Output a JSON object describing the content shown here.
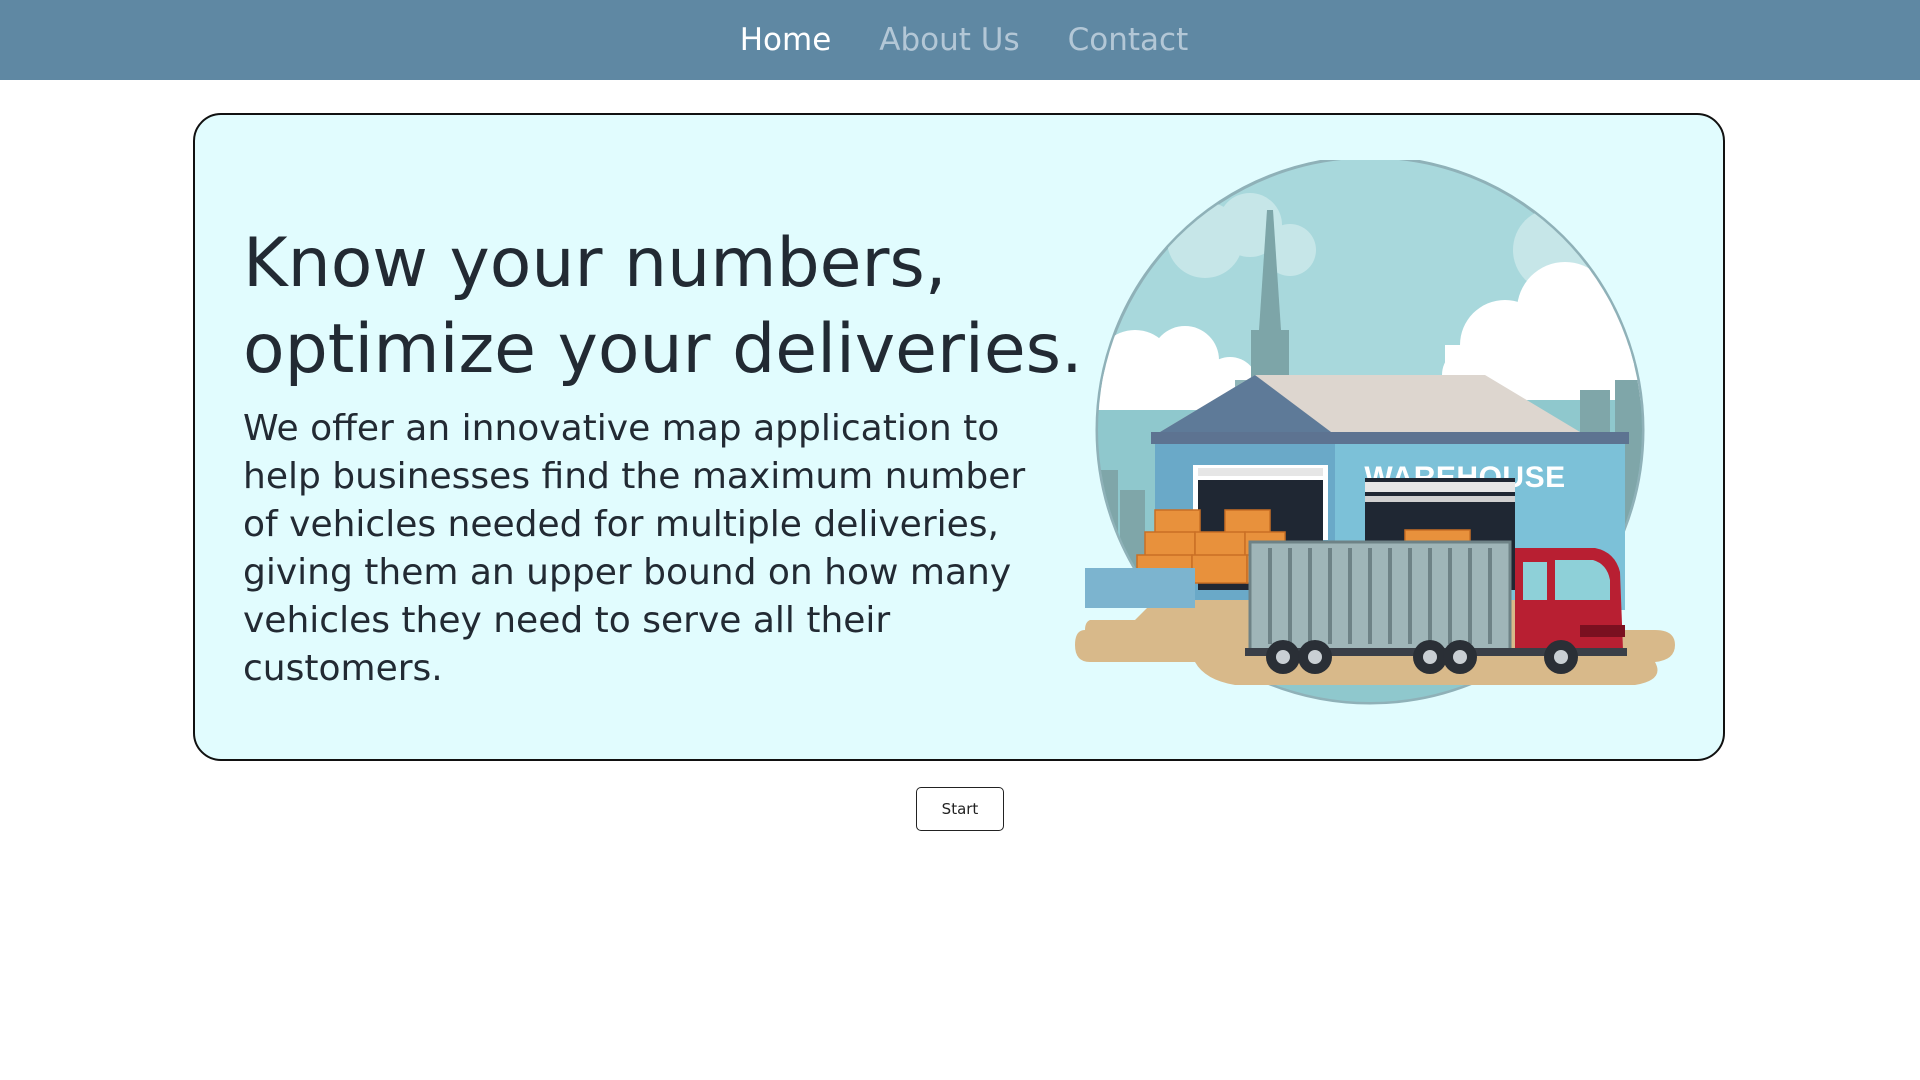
{
  "nav": {
    "items": [
      {
        "label": "Home",
        "active": true
      },
      {
        "label": "About Us",
        "active": false
      },
      {
        "label": "Contact",
        "active": false
      }
    ]
  },
  "hero": {
    "title_line1": "Know your numbers,",
    "title_line2": "optimize your deliveries.",
    "body": "We offer an innovative map application to help businesses find the maximum number of vehicles needed for multiple deliveries, giving them an upper bound on how many vehicles they need to serve all their customers.",
    "illustration": {
      "sign_text": "WAREHOUSE",
      "icon": "warehouse-truck-illustration"
    }
  },
  "actions": {
    "start_label": "Start"
  },
  "colors": {
    "navbar": "#5f88a3",
    "nav_active": "#ffffff",
    "nav_inactive": "#b3c7d6",
    "hero_background": "#e1fcfe",
    "text": "#222a33"
  }
}
